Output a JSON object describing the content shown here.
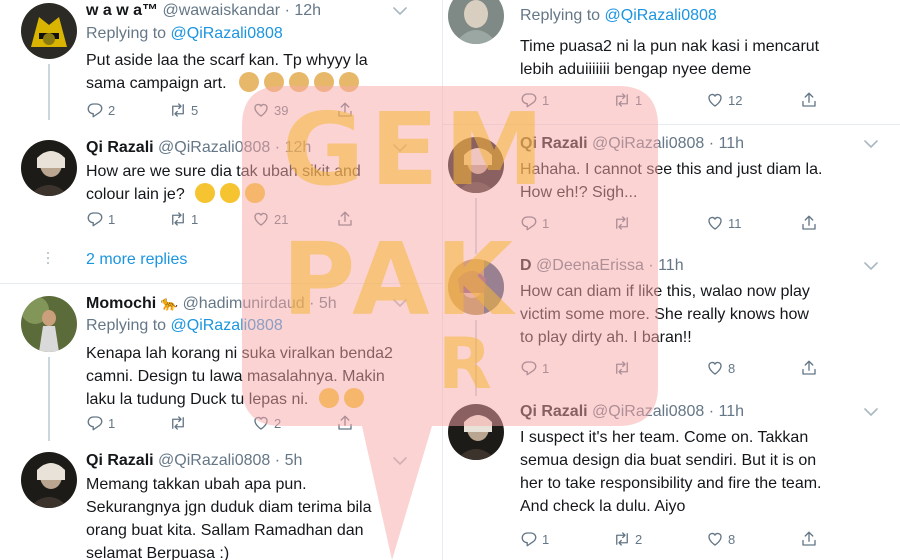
{
  "watermark": {
    "line1": "GEM",
    "line2": "PAK",
    "line3": "R"
  },
  "colors": {
    "accent": "#1b95e0",
    "muted": "#657786",
    "text": "#14171a",
    "border": "#e6ecf0",
    "watermark_pink": "#fbd0d0",
    "watermark_orange": "#f6b638"
  },
  "left": {
    "t1": {
      "name": "w a w a™",
      "handle": "@wawaiskandar",
      "time": "12h",
      "replying_label": "Replying to",
      "replying_to": "@QiRazali0808",
      "line1": "Put aside laa the scarf kan. Tp whyyy la",
      "line2": "sama campaign art.",
      "replies": "2",
      "retweets": "5",
      "likes": "39"
    },
    "t2": {
      "name": "Qi Razali",
      "handle": "@QiRazali0808",
      "time": "12h",
      "line1": "How are we sure dia tak ubah sikit and",
      "line2": "colour lain je?",
      "replies": "1",
      "retweets": "1",
      "likes": "21",
      "more_replies": "2 more replies"
    },
    "t3": {
      "name": "Momochi",
      "handle": "@hadimunirdaud",
      "time": "5h",
      "replying_label": "Replying to",
      "replying_to": "@QiRazali0808",
      "line1": "Kenapa lah korang ni suka viralkan benda2",
      "line2": "camni. Design tu lawa masalahnya. Makin",
      "line3": "laku la tudung Duck tu lepas ni.",
      "replies": "1",
      "retweets": "",
      "likes": "2"
    },
    "t4": {
      "name": "Qi Razali",
      "handle": "@QiRazali0808",
      "time": "5h",
      "line1": "Memang takkan ubah apa pun.",
      "line2": "Sekurangnya jgn duduk diam terima bila",
      "line3": "orang buat kita. Sallam Ramadhan dan",
      "line4": "selamat Berpuasa :)"
    }
  },
  "right": {
    "t1": {
      "replying_label": "Replying to",
      "replying_to": "@QiRazali0808",
      "line1": "Time puasa2 ni la pun nak kasi i mencarut",
      "line2": "lebih aduiiiiiii bengap nyee deme",
      "replies": "1",
      "retweets": "1",
      "likes": "12"
    },
    "t2": {
      "name": "Qi Razali",
      "handle": "@QiRazali0808",
      "time": "11h",
      "line1": "Hahaha. I cannot see this and just diam la.",
      "line2": "How eh!? Sigh...",
      "replies": "1",
      "retweets": "",
      "likes": "11"
    },
    "t3": {
      "name": "D",
      "handle": "@DeenaErissa",
      "time": "11h",
      "line1": "How can diam if like this, walao now play",
      "line2": "victim some more. She really knows how",
      "line3": "to play dirty ah. I baran!!",
      "replies": "1",
      "retweets": "",
      "likes": "8"
    },
    "t4": {
      "name": "Qi Razali",
      "handle": "@QiRazali0808",
      "time": "11h",
      "line1": "I suspect it's her team. Come on. Takkan",
      "line2": "semua design dia buat sendiri. But it is on",
      "line3": "her to take responsibility and fire the team.",
      "line4": "And check la dulu. Aiyo",
      "replies": "1",
      "retweets": "2",
      "likes": "8"
    }
  },
  "dot": "·"
}
